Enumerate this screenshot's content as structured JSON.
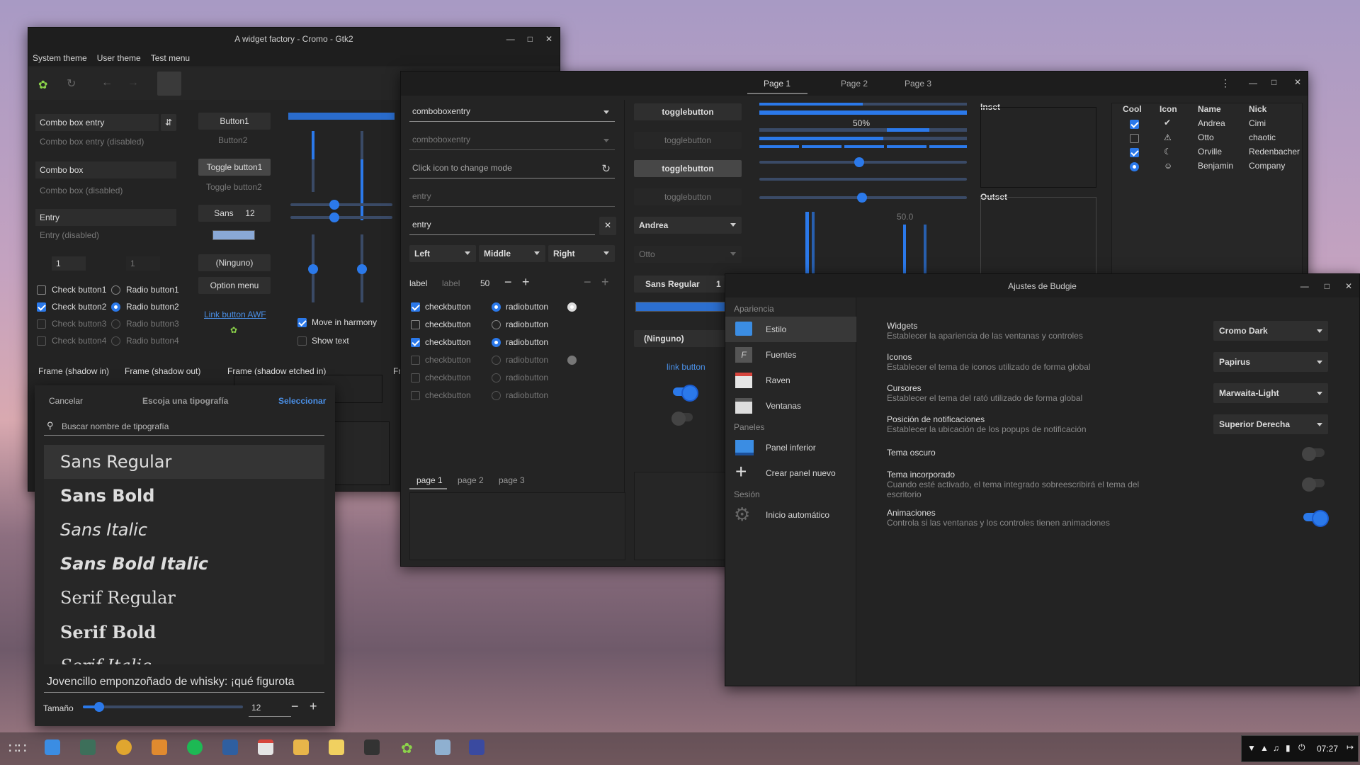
{
  "wf": {
    "title": "A widget factory - Cromo - Gtk2",
    "menu": [
      "System theme",
      "User theme",
      "Test menu"
    ],
    "combo_entry": "Combo box entry",
    "combo_entry_dis": "Combo box entry (disabled)",
    "combo": "Combo box",
    "combo_dis": "Combo box (disabled)",
    "entry": "Entry",
    "entry_dis": "Entry (disabled)",
    "spin1": "1",
    "spin2": "1",
    "checks": [
      "Check button1",
      "Check button2",
      "Check button3",
      "Check button4"
    ],
    "radios": [
      "Radio button1",
      "Radio button2",
      "Radio button3",
      "Radio button4"
    ],
    "button1": "Button1",
    "button2": "Button2",
    "toggle1": "Toggle button1",
    "toggle2": "Toggle button2",
    "font_name": "Sans",
    "font_size": "12",
    "ninguno": "(Ninguno)",
    "option_menu": "Option menu",
    "link": "Link button AWF",
    "move_harmony": "Move in harmony",
    "show_text": "Show text",
    "frames": [
      "Frame (shadow in)",
      "Frame (shadow out)",
      "Frame (shadow etched in)",
      "Fr"
    ]
  },
  "fc": {
    "cancel": "Cancelar",
    "title": "Escoja una tipografía",
    "select": "Seleccionar",
    "search": "Buscar nombre de tipografía",
    "fonts": [
      "Sans Regular",
      "Sans Bold",
      "Sans Italic",
      "Sans Bold Italic",
      "Serif Regular",
      "Serif Bold",
      "Serif Italic"
    ],
    "preview": "Jovencillo emponzoñado de whisky: ¡qué figurota",
    "size_label": "Tamaño",
    "size_value": "12",
    "size_fraction": 0.1
  },
  "g3": {
    "tabs": [
      "Page 1",
      "Page 2",
      "Page 3"
    ],
    "comboboxentry": "comboboxentry",
    "comboboxentry_dis": "comboboxentry",
    "mode": "Click icon to change mode",
    "entry_dis": "entry",
    "entry": "entry",
    "seg": [
      "Left",
      "Middle",
      "Right"
    ],
    "label": "label",
    "label_dis": "label",
    "spin": "50",
    "check": "checkbutton",
    "radio": "radiobutton",
    "togglebutton": "togglebutton",
    "andrea": "Andrea",
    "otto": "Otto",
    "font": "Sans Regular",
    "font_size": "1",
    "ninguno": "(Ninguno)",
    "link": "link button",
    "pct": "50%",
    "scale_val": "50.0",
    "inset": "Inset",
    "outset": "Outset",
    "tree_headers": [
      "Cool",
      "Icon",
      "Name",
      "Nick"
    ],
    "tree": [
      {
        "name": "Andrea",
        "nick": "Cimi"
      },
      {
        "name": "Otto",
        "nick": "chaotic"
      },
      {
        "name": "Orville",
        "nick": "Redenbacher"
      },
      {
        "name": "Benjamin",
        "nick": "Company"
      }
    ],
    "page_tabs": [
      "page 1",
      "page 2",
      "page 3"
    ]
  },
  "budgie": {
    "title": "Ajustes de Budgie",
    "sec1": "Apariencia",
    "sec2": "Paneles",
    "sec3": "Sesión",
    "nav": [
      "Estilo",
      "Fuentes",
      "Raven",
      "Ventanas",
      "Panel inferior",
      "Crear panel nuevo",
      "Inicio automático"
    ],
    "rows": [
      {
        "t": "Widgets",
        "d": "Establecer la apariencia de las ventanas y controles",
        "v": "Cromo Dark"
      },
      {
        "t": "Iconos",
        "d": "Establecer el tema de iconos utilizado de forma global",
        "v": "Papirus"
      },
      {
        "t": "Cursores",
        "d": "Establecer el tema del rató utilizado de forma global",
        "v": "Marwaita-Light"
      },
      {
        "t": "Posición de notificaciones",
        "d": "Establecer la ubicación de los popups de notificación",
        "v": "Superior Derecha"
      }
    ],
    "t1": "Tema oscuro",
    "t2": "Tema incorporado",
    "t2d": "Cuando esté activado, el tema integrado sobreescribirá el tema del escritorio",
    "t3": "Animaciones",
    "t3d": "Controla si las ventanas y los controles tienen animaciones"
  },
  "panel": {
    "time": "07:27"
  }
}
